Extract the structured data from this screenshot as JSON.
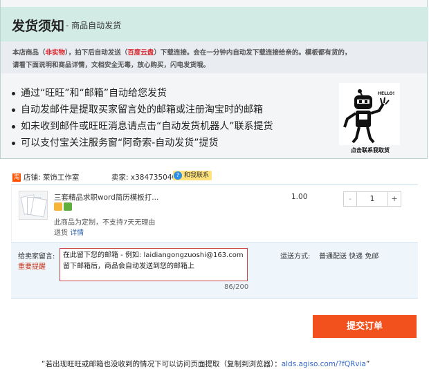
{
  "header": {
    "title": "发货须知",
    "subtitle": "- 商品自动发货"
  },
  "notice": {
    "line1_a": "本店商品（",
    "line1_b": "非实物",
    "line1_c": "），拍下后自动发送（",
    "line1_d": "百度云盘",
    "line1_e": "）下载连接。会在一分钟内自动发下载连接给亲的。模板都有货的，",
    "line2": "请看下面说明和商品详情，文档安全无毒，放心购买，闪电发货哦。"
  },
  "bullets": [
    "通过“旺旺”和“邮箱”自动给您发货",
    "自动发邮件是提取买家留言处的邮箱或注册淘宝时的邮箱",
    "如未收到邮件或旺旺消息请点击“自动发货机器人”联系提货",
    "可以支付宝关注服务窗“阿奇索-自动发货”提货"
  ],
  "robot": {
    "speech": "HELLO!",
    "caption": "点击联系我取货"
  },
  "shop": {
    "taobao_icon": "淘",
    "label": "店铺: 莱饰工作室",
    "seller_label": "卖家: x384735040",
    "contact_label": "和我联系",
    "contact_icon": "?"
  },
  "product": {
    "title": "三套精品求职word简历模板打...",
    "price": "1.00",
    "quantity": "1",
    "minus": "-",
    "plus": "+",
    "note": "此商品为定制，不支持7天无理由",
    "refund_label": "退货",
    "refund_link": "详情"
  },
  "message": {
    "label": "给卖家留言:",
    "warning": "重要提醒",
    "line1": "在此留下您的邮箱 - 例如: laidiangongzuoshi@163.com",
    "line2": "留下邮箱后，商品会自动发送到您的邮箱上",
    "count": "86/200"
  },
  "shipping": {
    "label": "运送方式:",
    "value": "普通配送 快递 免邮"
  },
  "submit_label": "提交订单",
  "footer": {
    "text": "“若出现旺旺或邮箱也没收到的情况下可以访问页面提取（复制到浏览器）：",
    "link": "alds.agiso.com/?fQRvia",
    "tail": "”"
  },
  "colors": {
    "accent": "#f2511d",
    "header_bg": "#d2ebe4",
    "warning": "#d9272e"
  }
}
